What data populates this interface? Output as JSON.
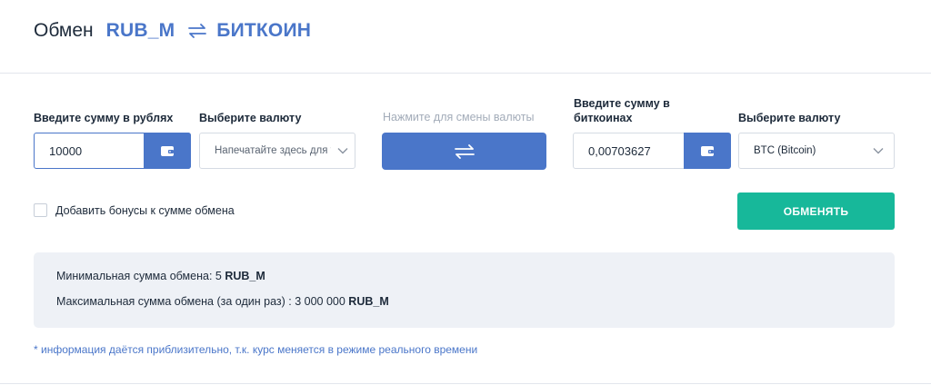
{
  "header": {
    "title_word": "Обмен",
    "from_currency": "RUB_M",
    "to_currency": "БИТКОИН",
    "swap_icon": "swap-arrows-icon"
  },
  "form": {
    "give_label": "Введите сумму в рублях",
    "give_value": "10000",
    "give_currency_label": "Выберите валюту",
    "give_currency_placeholder": "Напечатайте здесь для у...",
    "swap_hint": "Нажмите для смены валюты",
    "get_label_line1": "Введите сумму в",
    "get_label_line2": "биткоинах",
    "get_value": "0,00703627",
    "get_currency_label": "Выберите валюту",
    "get_currency_value": "BTC (Bitcoin)",
    "bonus_label": "Добавить бонусы к сумме обмена",
    "bonus_checked": false,
    "exchange_button": "ОБМЕНЯТЬ"
  },
  "info": {
    "min_prefix": "Минимальная сумма обмена: 5",
    "min_currency": "RUB_M",
    "max_prefix": "Максимальная сумма обмена (за один раз) : 3 000 000",
    "max_currency": "RUB_M"
  },
  "note": "* информация даётся приблизительно, т.к. курс меняется в режиме реального времени",
  "colors": {
    "accent": "#4a76c9",
    "exchange": "#17b89a",
    "info_bg": "#eef1f6"
  }
}
